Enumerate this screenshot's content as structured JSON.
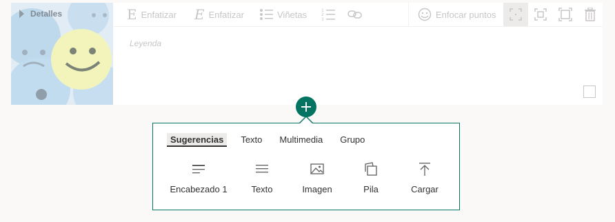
{
  "card": {
    "details_label": "Detalles",
    "caption_placeholder": "Leyenda",
    "toolbar": {
      "bold_label": "Enfatizar",
      "italic_label": "Enfatizar",
      "bullets_label": "Viñetas",
      "focus_label": "Enfocar puntos"
    }
  },
  "panel": {
    "tabs": [
      {
        "label": "Sugerencias",
        "active": true
      },
      {
        "label": "Texto",
        "active": false
      },
      {
        "label": "Multimedia",
        "active": false
      },
      {
        "label": "Grupo",
        "active": false
      }
    ],
    "items": [
      {
        "label": "Encabezado 1",
        "icon": "heading-icon"
      },
      {
        "label": "Texto",
        "icon": "text-icon"
      },
      {
        "label": "Imagen",
        "icon": "image-icon"
      },
      {
        "label": "Pila",
        "icon": "stack-icon"
      },
      {
        "label": "Cargar",
        "icon": "upload-icon"
      }
    ]
  },
  "colors": {
    "accent": "#037362",
    "disabled_text": "#c8c6c4"
  }
}
